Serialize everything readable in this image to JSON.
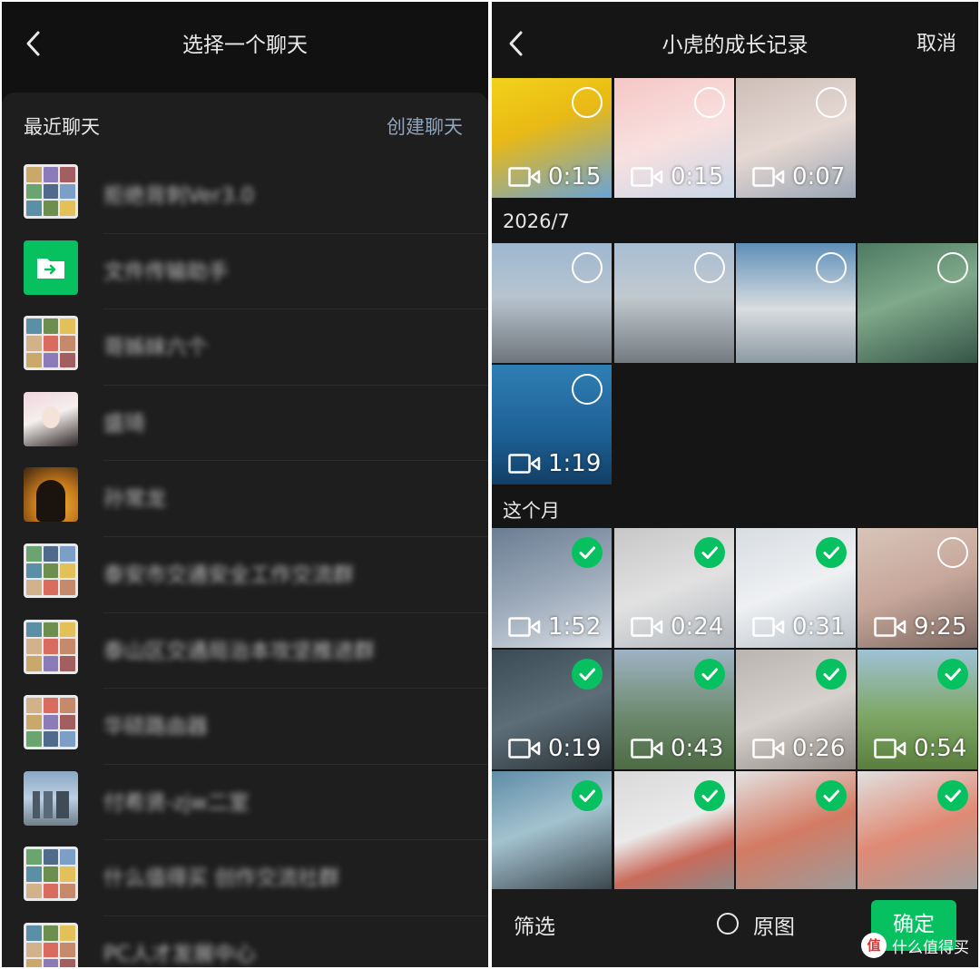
{
  "colors": {
    "accent": "#07c160",
    "link": "#8fa3bd"
  },
  "left": {
    "back_icon": "chevron-left-icon",
    "title": "选择一个聊天",
    "recent_label": "最近聊天",
    "create_label": "创建聊天",
    "chats": [
      {
        "name": "拒绝背刺Ver3.0",
        "avatar": "group-grid"
      },
      {
        "name": "文件传输助手",
        "avatar": "file-transfer-icon"
      },
      {
        "name": "哥姊妹六个",
        "avatar": "group-grid"
      },
      {
        "name": "盛琦",
        "avatar": "portrait"
      },
      {
        "name": "孙常龙",
        "avatar": "silhouette"
      },
      {
        "name": "泰安市交通安全工作交流群",
        "avatar": "group-grid"
      },
      {
        "name": "泰山区交通局治本攻坚推进群",
        "avatar": "group-grid"
      },
      {
        "name": "华硕路由器",
        "avatar": "group-grid"
      },
      {
        "name": "付希贤-zjw二室",
        "avatar": "city"
      },
      {
        "name": "什么值得买 创作交流社群",
        "avatar": "group-grid"
      },
      {
        "name": "PC人才发展中心",
        "avatar": "group-grid"
      }
    ]
  },
  "right": {
    "back_icon": "chevron-left-icon",
    "title": "小虎的成长记录",
    "cancel_label": "取消",
    "sections": [
      {
        "label": ""
      },
      {
        "label": "2026/7"
      },
      {
        "label": "这个月"
      }
    ],
    "tiles": [
      {
        "section": 0,
        "duration": "0:15",
        "selected": false,
        "video": true
      },
      {
        "section": 0,
        "duration": "0:15",
        "selected": false,
        "video": true
      },
      {
        "section": 0,
        "duration": "0:07",
        "selected": false,
        "video": true
      },
      {
        "section": 1,
        "duration": "",
        "selected": false,
        "video": false
      },
      {
        "section": 1,
        "duration": "",
        "selected": false,
        "video": false
      },
      {
        "section": 1,
        "duration": "",
        "selected": false,
        "video": false
      },
      {
        "section": 1,
        "duration": "",
        "selected": false,
        "video": false
      },
      {
        "section": 1,
        "duration": "1:19",
        "selected": false,
        "video": true
      },
      {
        "section": 2,
        "duration": "1:52",
        "selected": true,
        "video": true
      },
      {
        "section": 2,
        "duration": "0:24",
        "selected": true,
        "video": true
      },
      {
        "section": 2,
        "duration": "0:31",
        "selected": true,
        "video": true
      },
      {
        "section": 2,
        "duration": "9:25",
        "selected": false,
        "video": true
      },
      {
        "section": 2,
        "duration": "0:19",
        "selected": true,
        "video": true
      },
      {
        "section": 2,
        "duration": "0:43",
        "selected": true,
        "video": true
      },
      {
        "section": 2,
        "duration": "0:26",
        "selected": true,
        "video": true
      },
      {
        "section": 2,
        "duration": "0:54",
        "selected": true,
        "video": true
      },
      {
        "section": 2,
        "duration": "",
        "selected": true,
        "video": false
      },
      {
        "section": 2,
        "duration": "",
        "selected": true,
        "video": false
      },
      {
        "section": 2,
        "duration": "",
        "selected": true,
        "video": false
      },
      {
        "section": 2,
        "duration": "",
        "selected": true,
        "video": false
      }
    ],
    "bottom": {
      "filter_label": "筛选",
      "original_label": "原图",
      "confirm_label": "确定"
    },
    "watermark": {
      "logo": "值",
      "text": "什么值得买"
    }
  }
}
